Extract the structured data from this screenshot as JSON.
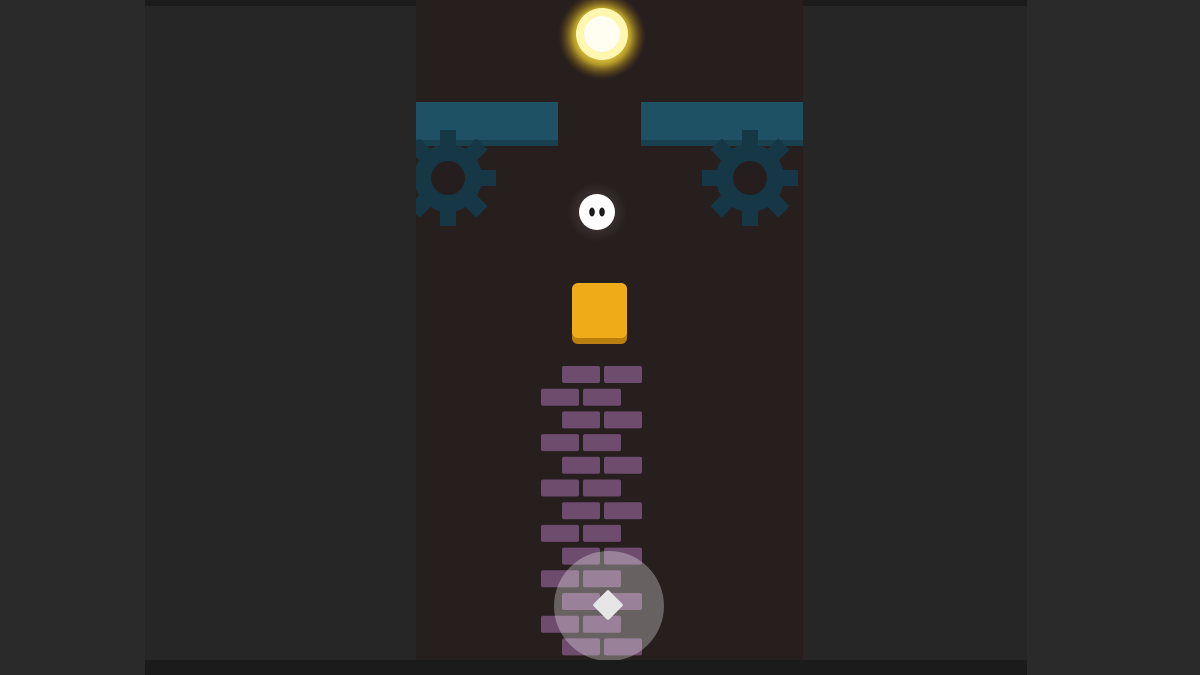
{
  "game": {
    "scene": "tower-climb-level",
    "background_color": "#261e1e"
  },
  "objects": {
    "sun": {
      "icon": "glowing-sun-orb",
      "color": "#ffe84a"
    },
    "player": {
      "icon": "white-round-ghost-with-eyes",
      "color": "#ffffff"
    },
    "block": {
      "icon": "orange-square-block",
      "color": "#f0ac18"
    },
    "ledges": {
      "color": "#1e5163"
    },
    "gears": {
      "color": "#163745",
      "count": 2
    },
    "brick_tower": {
      "color": "#6d4c6e"
    }
  },
  "controls": {
    "action_button": {
      "icon": "diamond-icon"
    }
  }
}
